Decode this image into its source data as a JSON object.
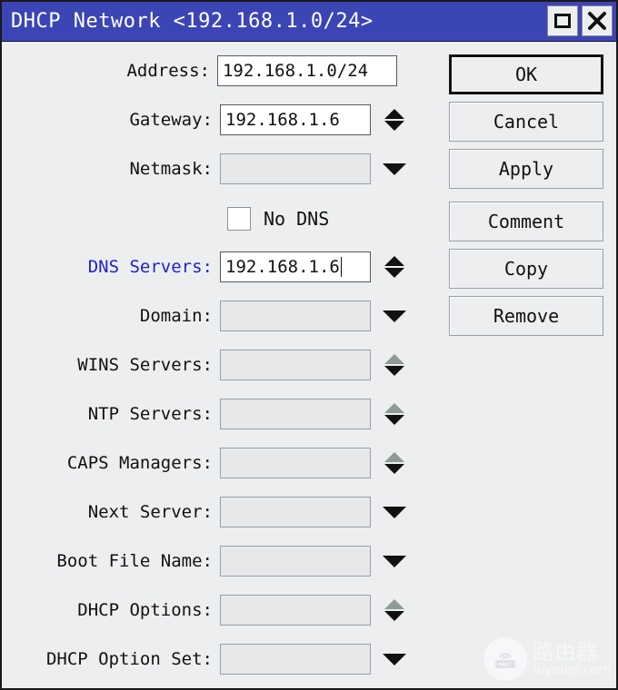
{
  "window": {
    "title": "DHCP Network <192.168.1.0/24>",
    "maximize_icon": "maximize-icon",
    "close_icon": "close-icon",
    "title_bar_color": "#3b45b5",
    "active_label_color": "#2222cc"
  },
  "form": {
    "rows": [
      {
        "label": "Address:",
        "value": "192.168.1.0/24",
        "filled": true,
        "widget": "none",
        "active": false
      },
      {
        "label": "Gateway:",
        "value": "192.168.1.6",
        "filled": true,
        "widget": "spinner",
        "active": false
      },
      {
        "label": "Netmask:",
        "value": "",
        "filled": false,
        "widget": "dropdown",
        "active": false
      },
      {
        "label": "DNS Servers:",
        "value": "192.168.1.6",
        "filled": true,
        "widget": "spinner",
        "active": true
      },
      {
        "label": "Domain:",
        "value": "",
        "filled": false,
        "widget": "dropdown",
        "active": false
      },
      {
        "label": "WINS Servers:",
        "value": "",
        "filled": false,
        "widget": "list",
        "active": false
      },
      {
        "label": "NTP Servers:",
        "value": "",
        "filled": false,
        "widget": "list",
        "active": false
      },
      {
        "label": "CAPS Managers:",
        "value": "",
        "filled": false,
        "widget": "list",
        "active": false
      },
      {
        "label": "Next Server:",
        "value": "",
        "filled": false,
        "widget": "dropdown",
        "active": false
      },
      {
        "label": "Boot File Name:",
        "value": "",
        "filled": false,
        "widget": "dropdown",
        "active": false
      },
      {
        "label": "DHCP Options:",
        "value": "",
        "filled": false,
        "widget": "list",
        "active": false
      },
      {
        "label": "DHCP Option Set:",
        "value": "",
        "filled": false,
        "widget": "dropdown",
        "active": false
      }
    ],
    "checkbox": {
      "label": "No DNS",
      "checked": false
    }
  },
  "buttons": [
    {
      "label": "OK",
      "default": true,
      "gap": false
    },
    {
      "label": "Cancel",
      "default": false,
      "gap": false
    },
    {
      "label": "Apply",
      "default": false,
      "gap": false
    },
    {
      "label": "Comment",
      "default": false,
      "gap": true
    },
    {
      "label": "Copy",
      "default": false,
      "gap": false
    },
    {
      "label": "Remove",
      "default": false,
      "gap": false
    }
  ],
  "watermark": {
    "cn": "路由器",
    "en": "luyouqi.com"
  }
}
